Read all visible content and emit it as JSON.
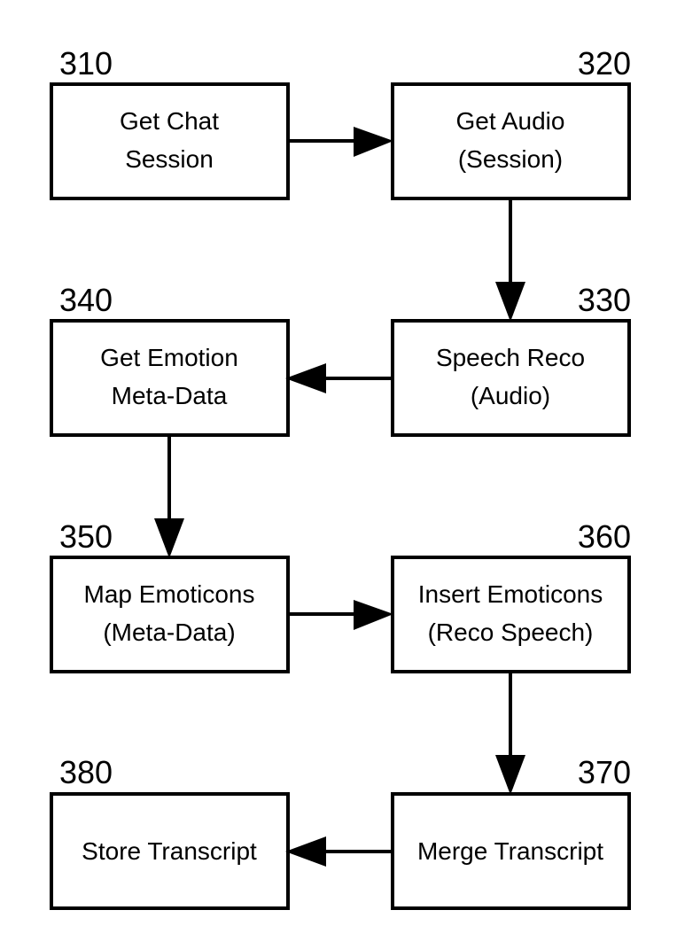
{
  "diagram": {
    "steps": [
      {
        "id": "310",
        "line1": "Get Chat",
        "line2": "Session"
      },
      {
        "id": "320",
        "line1": "Get Audio",
        "line2": "(Session)"
      },
      {
        "id": "330",
        "line1": "Speech Reco",
        "line2": "(Audio)"
      },
      {
        "id": "340",
        "line1": "Get Emotion",
        "line2": "Meta-Data"
      },
      {
        "id": "350",
        "line1": "Map Emoticons",
        "line2": "(Meta-Data)"
      },
      {
        "id": "360",
        "line1": "Insert Emoticons",
        "line2": "(Reco Speech)"
      },
      {
        "id": "370",
        "line1": "Merge Transcript",
        "line2": ""
      },
      {
        "id": "380",
        "line1": "Store Transcript",
        "line2": ""
      }
    ],
    "flows": [
      {
        "from": "310",
        "to": "320"
      },
      {
        "from": "320",
        "to": "330"
      },
      {
        "from": "330",
        "to": "340"
      },
      {
        "from": "340",
        "to": "350"
      },
      {
        "from": "350",
        "to": "360"
      },
      {
        "from": "360",
        "to": "370"
      },
      {
        "from": "370",
        "to": "380"
      }
    ]
  }
}
